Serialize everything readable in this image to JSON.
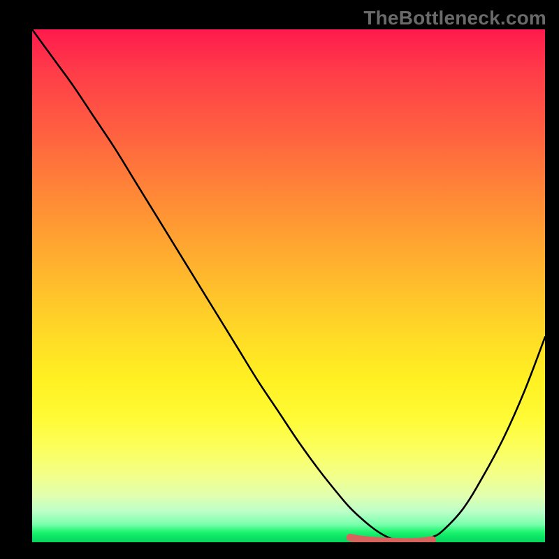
{
  "attribution": "TheBottleneck.com",
  "colors": {
    "curve": "#000000",
    "marker": "#d9635e",
    "marker_width": 11
  },
  "chart_data": {
    "type": "line",
    "title": "",
    "xlabel": "",
    "ylabel": "",
    "xlim": [
      0,
      100
    ],
    "ylim": [
      0,
      100
    ],
    "grid": false,
    "series": [
      {
        "name": "bottleneck-curve",
        "x": [
          0,
          4,
          8,
          12,
          16,
          20,
          24,
          28,
          32,
          36,
          40,
          44,
          48,
          52,
          56,
          60,
          62,
          64,
          66,
          68,
          70,
          72,
          74,
          76,
          78,
          80,
          84,
          88,
          92,
          96,
          100
        ],
        "y": [
          100,
          94.5,
          89,
          83,
          77,
          70.5,
          64,
          57.5,
          51,
          44.5,
          38,
          31.5,
          25.5,
          19.5,
          14,
          9,
          6.7,
          4.8,
          3.1,
          1.7,
          0.7,
          0.2,
          0,
          0.3,
          1.0,
          2.2,
          6.5,
          13,
          20.5,
          29.5,
          40
        ]
      }
    ],
    "annotations": [
      {
        "name": "optimal-range",
        "x": [
          62,
          64,
          66,
          68,
          70,
          72,
          74,
          76,
          78
        ],
        "y": [
          0.9,
          0.55,
          0.35,
          0.2,
          0.1,
          0.05,
          0.05,
          0.15,
          0.45
        ]
      }
    ]
  }
}
